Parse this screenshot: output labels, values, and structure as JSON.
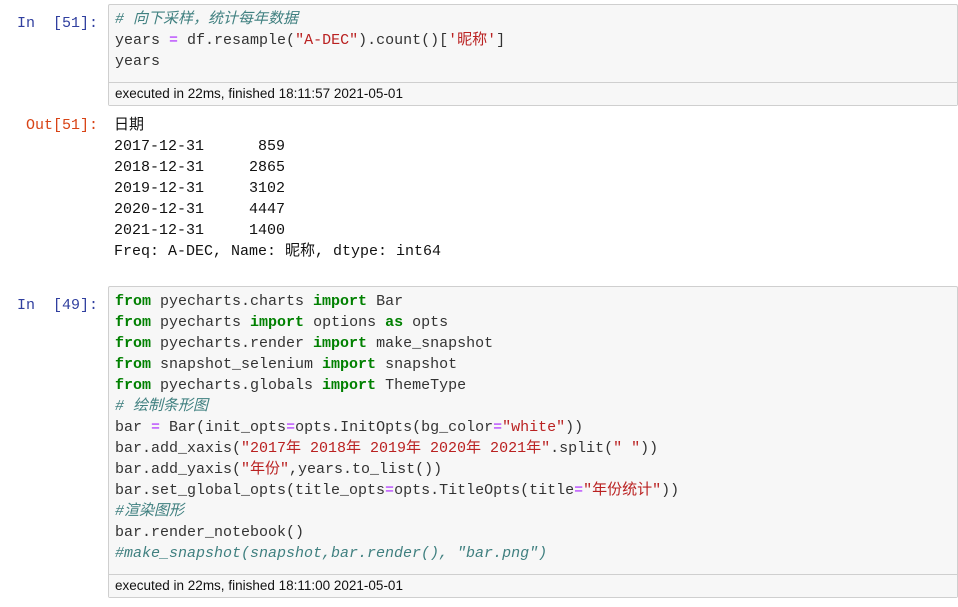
{
  "cells": [
    {
      "prompt": "In  [51]:",
      "code_lines": [
        [
          {
            "t": "# 向下采样，统计每年数据",
            "c": "cm"
          }
        ],
        [
          {
            "t": "years "
          },
          {
            "t": "=",
            "c": "op"
          },
          {
            "t": " df.resample("
          },
          {
            "t": "\"A-DEC\"",
            "c": "str"
          },
          {
            "t": ").count()["
          },
          {
            "t": "'昵称'",
            "c": "str"
          },
          {
            "t": "]"
          }
        ],
        [
          {
            "t": "years"
          }
        ]
      ],
      "exec_text": "executed in 22ms, finished 18:11:57 2021-05-01",
      "output_prompt": "Out[51]:",
      "output_lines": [
        "日期",
        "2017-12-31      859",
        "2018-12-31     2865",
        "2019-12-31     3102",
        "2020-12-31     4447",
        "2021-12-31     1400",
        "Freq: A-DEC, Name: 昵称, dtype: int64"
      ]
    },
    {
      "prompt": "In  [49]:",
      "code_lines": [
        [
          {
            "t": "from",
            "c": "kw"
          },
          {
            "t": " pyecharts.charts "
          },
          {
            "t": "import",
            "c": "kw"
          },
          {
            "t": " Bar"
          }
        ],
        [
          {
            "t": "from",
            "c": "kw"
          },
          {
            "t": " pyecharts "
          },
          {
            "t": "import",
            "c": "kw"
          },
          {
            "t": " options "
          },
          {
            "t": "as",
            "c": "kw"
          },
          {
            "t": " opts"
          }
        ],
        [
          {
            "t": "from",
            "c": "kw"
          },
          {
            "t": " pyecharts.render "
          },
          {
            "t": "import",
            "c": "kw"
          },
          {
            "t": " make_snapshot"
          }
        ],
        [
          {
            "t": "from",
            "c": "kw"
          },
          {
            "t": " snapshot_selenium "
          },
          {
            "t": "import",
            "c": "kw"
          },
          {
            "t": " snapshot"
          }
        ],
        [
          {
            "t": "from",
            "c": "kw"
          },
          {
            "t": " pyecharts.globals "
          },
          {
            "t": "import",
            "c": "kw"
          },
          {
            "t": " ThemeType"
          }
        ],
        [
          {
            "t": "# 绘制条形图",
            "c": "cm"
          }
        ],
        [
          {
            "t": "bar "
          },
          {
            "t": "=",
            "c": "op"
          },
          {
            "t": " Bar(init_opts"
          },
          {
            "t": "=",
            "c": "op"
          },
          {
            "t": "opts.InitOpts(bg_color"
          },
          {
            "t": "=",
            "c": "op"
          },
          {
            "t": "\"white\"",
            "c": "str"
          },
          {
            "t": "))"
          }
        ],
        [
          {
            "t": "bar.add_xaxis("
          },
          {
            "t": "\"2017年 2018年 2019年 2020年 2021年\"",
            "c": "str"
          },
          {
            "t": ".split("
          },
          {
            "t": "\" \"",
            "c": "str"
          },
          {
            "t": "))"
          }
        ],
        [
          {
            "t": "bar.add_yaxis("
          },
          {
            "t": "\"年份\"",
            "c": "str"
          },
          {
            "t": ",years.to_list())"
          }
        ],
        [
          {
            "t": "bar.set_global_opts(title_opts"
          },
          {
            "t": "=",
            "c": "op"
          },
          {
            "t": "opts.TitleOpts(title"
          },
          {
            "t": "=",
            "c": "op"
          },
          {
            "t": "\"年份统计\"",
            "c": "str"
          },
          {
            "t": "))"
          }
        ],
        [
          {
            "t": "#渲染图形",
            "c": "cm"
          }
        ],
        [
          {
            "t": "bar.render_notebook()"
          }
        ],
        [
          {
            "t": "#make_snapshot(snapshot,bar.render(), \"bar.png\")",
            "c": "cm"
          }
        ]
      ],
      "exec_text": "executed in 22ms, finished 18:11:00 2021-05-01"
    }
  ]
}
